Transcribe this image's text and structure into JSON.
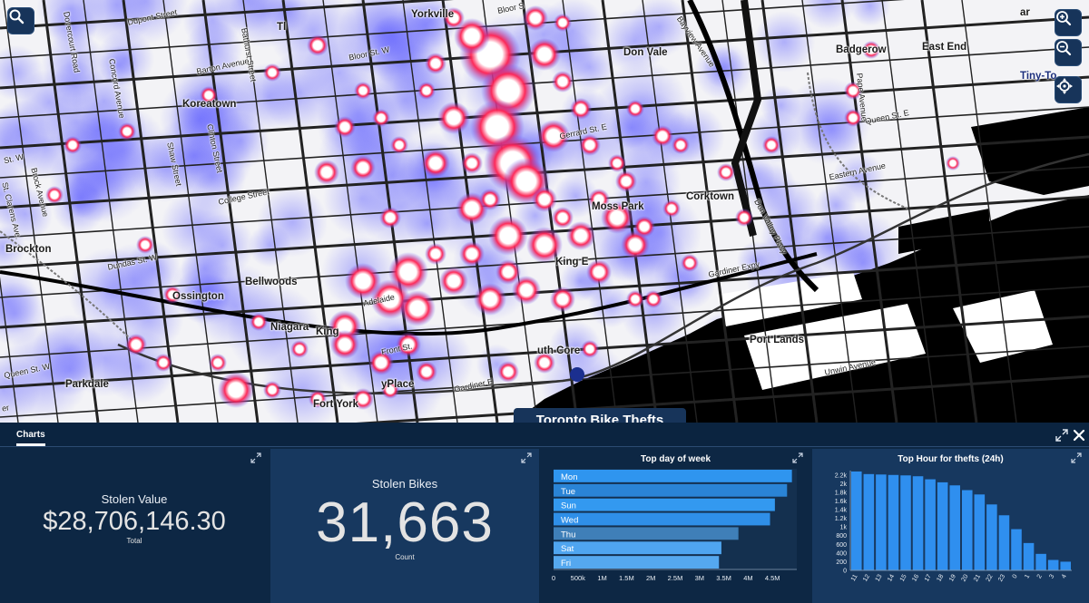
{
  "map": {
    "labels": [
      {
        "id": "yorkville",
        "text": "Yorkville",
        "street": false
      },
      {
        "id": "bloor-st",
        "text": "Bloor S",
        "street": true
      },
      {
        "id": "don-vale",
        "text": "Don Vale",
        "street": false
      },
      {
        "id": "badgerow",
        "text": "Badgerow",
        "street": false
      },
      {
        "id": "east-end",
        "text": "East End",
        "street": false
      },
      {
        "id": "tiny-to",
        "text": "Tiny-To",
        "street": false
      },
      {
        "id": "ar",
        "text": "ar",
        "street": false
      },
      {
        "id": "tl",
        "text": "Tl",
        "street": false
      },
      {
        "id": "dupont-st",
        "text": "Dupont Street",
        "street": true
      },
      {
        "id": "barton-ave",
        "text": "Barton Avenue",
        "street": true
      },
      {
        "id": "bloor-st-w",
        "text": "Bloor St. W",
        "street": true
      },
      {
        "id": "koreatown",
        "text": "Koreatown",
        "street": false
      },
      {
        "id": "gerrard-st-e",
        "text": "Gerrard St. E",
        "street": true
      },
      {
        "id": "queen-st-e",
        "text": "Queen St. E",
        "street": true
      },
      {
        "id": "eastern-ave",
        "text": "Eastern Avenue",
        "street": true
      },
      {
        "id": "st-w",
        "text": "St. W",
        "street": true
      },
      {
        "id": "college-st",
        "text": "College Street",
        "street": true
      },
      {
        "id": "moss-park",
        "text": "Moss Park",
        "street": false
      },
      {
        "id": "corktown",
        "text": "Corktown",
        "street": false
      },
      {
        "id": "don-valley-pkwy",
        "text": "Don Valley Pkwy",
        "street": true
      },
      {
        "id": "brockton",
        "text": "Brockton",
        "street": false
      },
      {
        "id": "dundas-st-w",
        "text": "Dundas St. W",
        "street": true
      },
      {
        "id": "king-east",
        "text": "King E",
        "street": false
      },
      {
        "id": "gardiner-expy",
        "text": "Gardiner Expy",
        "street": true
      },
      {
        "id": "ossington",
        "text": "Ossington",
        "street": false
      },
      {
        "id": "bellwoods",
        "text": "Bellwoods",
        "street": false
      },
      {
        "id": "niagara",
        "text": "Niagara",
        "street": false
      },
      {
        "id": "king-west",
        "text": "King",
        "street": false
      },
      {
        "id": "adelaide",
        "text": "Adelaide",
        "street": true
      },
      {
        "id": "front-st",
        "text": "Front St.",
        "street": true
      },
      {
        "id": "south-core",
        "text": "uth Core",
        "street": false
      },
      {
        "id": "port-lands",
        "text": "Port Lands",
        "street": false
      },
      {
        "id": "unwin-ave",
        "text": "Unwin Avenue",
        "street": true
      },
      {
        "id": "queen-st-w",
        "text": "Queen St. W",
        "street": true
      },
      {
        "id": "parkdale",
        "text": "Parkdale",
        "street": false
      },
      {
        "id": "city-place",
        "text": "yPlace",
        "street": false
      },
      {
        "id": "gardiner-w",
        "text": "Gardiner E",
        "street": true
      },
      {
        "id": "fort-york",
        "text": "Fort York",
        "street": false
      },
      {
        "id": "dovercourt-rd",
        "text": "Dovercourt Road",
        "street": true
      },
      {
        "id": "concord-ave",
        "text": "Concord Avenue",
        "street": true
      },
      {
        "id": "bathurst-st",
        "text": "Bathurst Street",
        "street": true
      },
      {
        "id": "shaw-st",
        "text": "Shaw Street",
        "street": true
      },
      {
        "id": "clinton-st",
        "text": "Clinton Street",
        "street": true
      },
      {
        "id": "st-clarens",
        "text": "St. Clarens Ave.",
        "street": true
      },
      {
        "id": "brock-ave",
        "text": "Brock Avenue",
        "street": true
      },
      {
        "id": "bayview-ave",
        "text": "Bayview Avenue",
        "street": true
      },
      {
        "id": "pape-ave",
        "text": "Pape Avenue",
        "street": true
      },
      {
        "id": "er",
        "text": "er",
        "street": true
      }
    ],
    "layer_title": "Toronto Bike Thefts",
    "controls": {
      "search_icon": "search-icon",
      "zoom_in_icon": "zoom-in-icon",
      "zoom_out_icon": "zoom-out-icon",
      "locate_icon": "locate-icon"
    },
    "colors": {
      "heat_low": "#5b5bff",
      "heat_mid": "#ff2050",
      "heat_high": "#ffffff",
      "water": "#000000"
    }
  },
  "panel": {
    "tab_label": "Charts",
    "stolen_value": {
      "title": "Stolen Value",
      "value": "$28,706,146.30",
      "subtitle": "Total"
    },
    "stolen_bikes": {
      "title": "Stolen Bikes",
      "value": "31,663",
      "subtitle": "Count"
    }
  },
  "chart_data": [
    {
      "type": "bar",
      "orientation": "horizontal",
      "title": "Top day of week",
      "categories": [
        "Mon",
        "Tue",
        "Sun",
        "Wed",
        "Thu",
        "Sat",
        "Fri"
      ],
      "values": [
        4900000,
        4800000,
        4550000,
        4450000,
        3800000,
        3450000,
        3400000
      ],
      "xlim": [
        0,
        5000000
      ],
      "x_ticks": [
        "0",
        "500k",
        "1M",
        "1.5M",
        "2M",
        "2.5M",
        "3M",
        "3.5M",
        "4M",
        "4.5M"
      ],
      "colors": [
        "#2f95ef",
        "#2a84d6",
        "#3399f0",
        "#2f8fe8",
        "#3f7fb8",
        "#4fa5f0",
        "#55a8ef"
      ]
    },
    {
      "type": "bar",
      "title": "Top Hour for thefts (24h)",
      "categories": [
        "11",
        "12",
        "13",
        "14",
        "15",
        "16",
        "17",
        "18",
        "19",
        "20",
        "21",
        "22",
        "23",
        "0",
        "1",
        "2",
        "3",
        "4"
      ],
      "values": [
        2280,
        2220,
        2210,
        2200,
        2190,
        2170,
        2100,
        2030,
        1960,
        1850,
        1750,
        1520,
        1270,
        950,
        630,
        380,
        240,
        200
      ],
      "ylim": [
        0,
        2300
      ],
      "y_ticks": [
        "0",
        "200",
        "400",
        "600",
        "800",
        "1k",
        "1.2k",
        "1.4k",
        "1.6k",
        "1.8k",
        "2k",
        "2.2k"
      ],
      "color": "#2f8fef"
    }
  ]
}
